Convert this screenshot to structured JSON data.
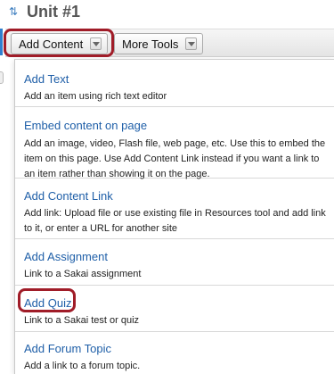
{
  "header": {
    "title": "Unit #1",
    "reorder_icon": "reorder-arrows-icon"
  },
  "toolbar": {
    "add_content_label": "Add Content",
    "more_tools_label": "More Tools"
  },
  "menu": {
    "items": [
      {
        "title": "Add Text",
        "description": "Add an item using rich text editor"
      },
      {
        "title": "Embed content on page",
        "description": "Add an image, video, Flash file, web page, etc. Use this to embed the item on this page. Use Add Content Link instead if you want a link to an item rather than showing it on the page."
      },
      {
        "title": "Add Content Link",
        "description": "Add link: Upload file or use existing file in Resources tool and add link to it, or enter a URL for another site"
      },
      {
        "title": "Add Assignment",
        "description": "Link to a Sakai assignment"
      },
      {
        "title": "Add Quiz",
        "description": "Link to a Sakai test or quiz"
      },
      {
        "title": "Add Forum Topic",
        "description": "Add a link to a forum topic."
      }
    ]
  },
  "colors": {
    "highlight": "#a01c28",
    "link": "#1f5fa8",
    "accent": "#2f7fcf"
  }
}
